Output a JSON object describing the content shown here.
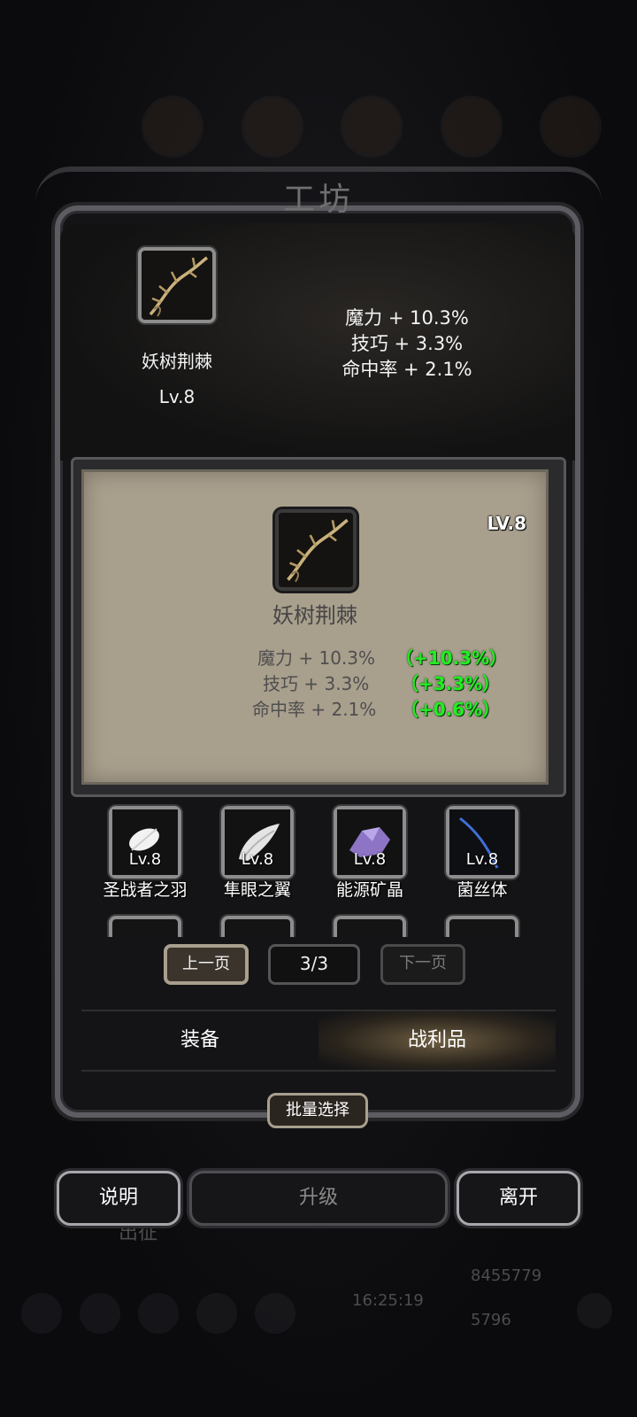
{
  "title": "工坊",
  "background": {
    "march_label": "出征",
    "time": "16:25:19",
    "gold": "8455779",
    "gems": "5796"
  },
  "top_item": {
    "name": "妖树荆棘",
    "level": "Lv.8",
    "icon": "thorn-branch-icon",
    "stats": [
      "魔力 + 10.3%",
      "技巧 + 3.3%",
      "命中率 + 2.1%"
    ]
  },
  "detail": {
    "level": "LV.8",
    "name": "妖树荆棘",
    "icon": "thorn-branch-icon",
    "stats": [
      {
        "label": "魔力 + 10.3%",
        "bonus": "（+10.3%）"
      },
      {
        "label": "技巧 + 3.3%",
        "bonus": "（+3.3%）"
      },
      {
        "label": "命中率 + 2.1%",
        "bonus": "（+0.6%）"
      }
    ]
  },
  "inventory": [
    {
      "name": "圣战者之羽",
      "level": "Lv.8",
      "icon": "white-feather-icon"
    },
    {
      "name": "隼眼之翼",
      "level": "Lv.8",
      "icon": "wing-icon"
    },
    {
      "name": "能源矿晶",
      "level": "Lv.8",
      "icon": "purple-crystal-icon"
    },
    {
      "name": "菌丝体",
      "level": "Lv.8",
      "icon": "mycelium-icon"
    }
  ],
  "pagination": {
    "prev_label": "上一页",
    "page": "3/3",
    "next_label": "下一页"
  },
  "tabs": {
    "equipment": "装备",
    "loot": "战利品"
  },
  "batch_select": "批量选择",
  "actions": {
    "help": "说明",
    "upgrade": "升级",
    "leave": "离开"
  }
}
